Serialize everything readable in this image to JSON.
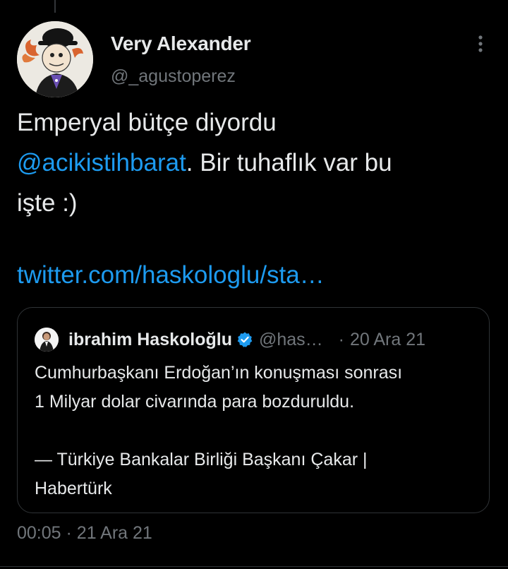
{
  "author": {
    "name": "Very Alexander",
    "handle": "@_agustoperez"
  },
  "tweet": {
    "text_before": "Emperyal bütçe diyordu\n",
    "mention": "@acikistihbarat",
    "text_after": ". Bir tuhaflık var bu\nişte :)",
    "link": "twitter.com/haskologlu/sta…",
    "time": "00:05",
    "separator": "·",
    "date": "21 Ara 21"
  },
  "quoted_tweet": {
    "name": "ibrahim Haskoloğlu",
    "verified": true,
    "handle": "@has…",
    "separator": "·",
    "date": "20 Ara 21",
    "text_line1": "Cumhurbaşkanı Erdoğan’ın konuşması sonrası",
    "text_line2": "1 Milyar dolar civarında para bozduruldu.",
    "text_line3": "— Türkiye Bankalar Birliği Başkanı Çakar |",
    "text_line4": "Habertürk"
  },
  "icons": {
    "more": "more-vertical-icon",
    "verified": "verified-badge-icon"
  },
  "colors": {
    "background": "#000000",
    "text": "#e7e9ea",
    "secondary_text": "#71767b",
    "accent": "#1d9bf0",
    "border": "#2f3336"
  }
}
